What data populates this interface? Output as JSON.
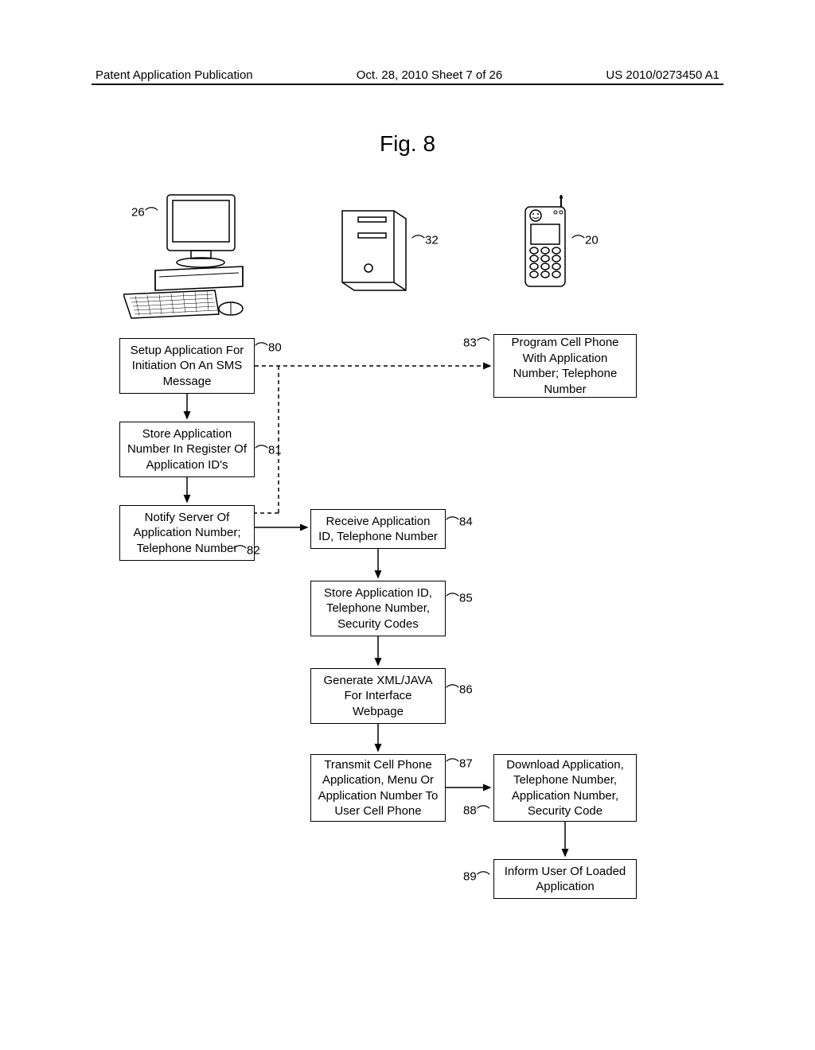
{
  "header": {
    "left": "Patent Application Publication",
    "center": "Oct. 28, 2010  Sheet 7 of 26",
    "right": "US 2010/0273450 A1"
  },
  "figure_title": "Fig. 8",
  "refs": {
    "r26": "26",
    "r32": "32",
    "r20": "20",
    "r80": "80",
    "r81": "81",
    "r82": "82",
    "r83": "83",
    "r84": "84",
    "r85": "85",
    "r86": "86",
    "r87": "87",
    "r88": "88",
    "r89": "89"
  },
  "boxes": {
    "b80": "Setup Application For Initiation On An SMS Message",
    "b81": "Store Application Number In Register Of Application ID's",
    "b82": "Notify Server Of Application Number; Telephone Number",
    "b83": "Program Cell Phone With Application Number; Telephone Number",
    "b84": "Receive Application ID, Telephone Number",
    "b85": "Store Application ID, Telephone Number, Security Codes",
    "b86": "Generate XML/JAVA For Interface Webpage",
    "b87": "Transmit Cell Phone Application, Menu Or Application Number To User Cell Phone",
    "b88": "Download Application, Telephone Number, Application Number, Security Code",
    "b89": "Inform User Of Loaded Application"
  }
}
